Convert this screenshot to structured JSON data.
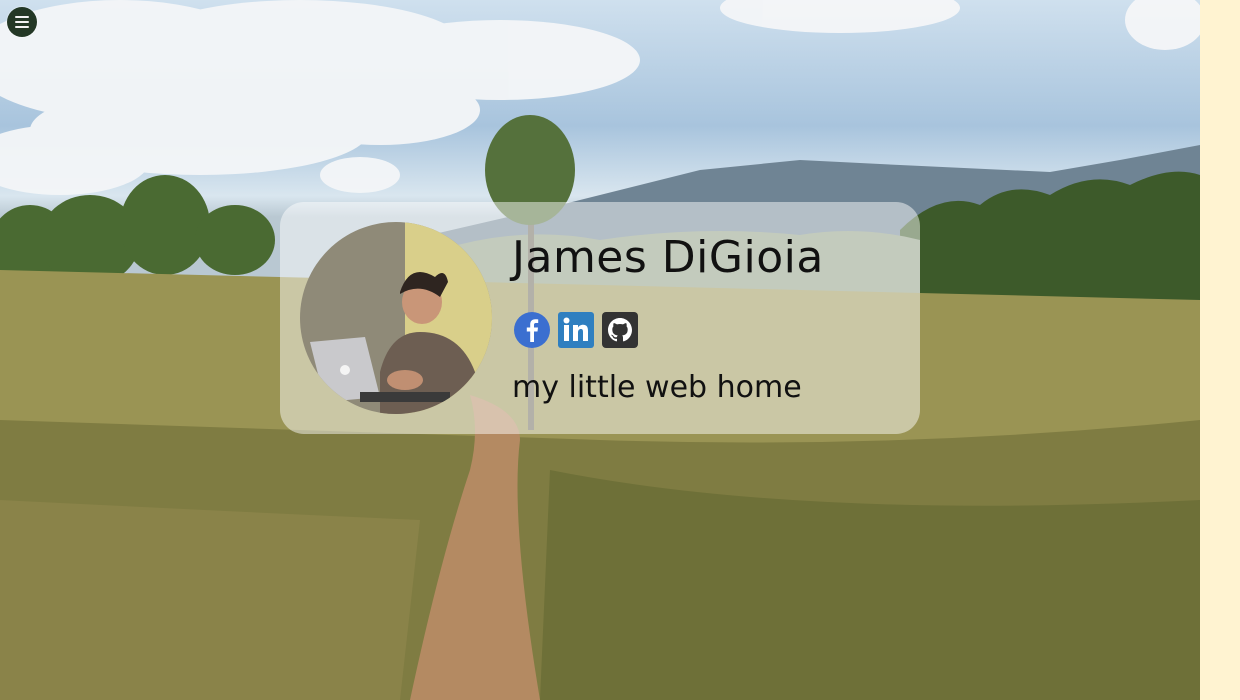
{
  "profile": {
    "name": "James DiGioia",
    "tagline": "my little web home"
  },
  "menu": {
    "icon": "hamburger-icon"
  },
  "socials": [
    {
      "icon": "facebook-icon",
      "color": "#3b6fd0"
    },
    {
      "icon": "linkedin-icon",
      "color": "#2f7fc0"
    },
    {
      "icon": "github-icon",
      "color": "#333333"
    }
  ],
  "colors": {
    "sidebar": "#fff3d1",
    "menu_button": "#243826"
  }
}
